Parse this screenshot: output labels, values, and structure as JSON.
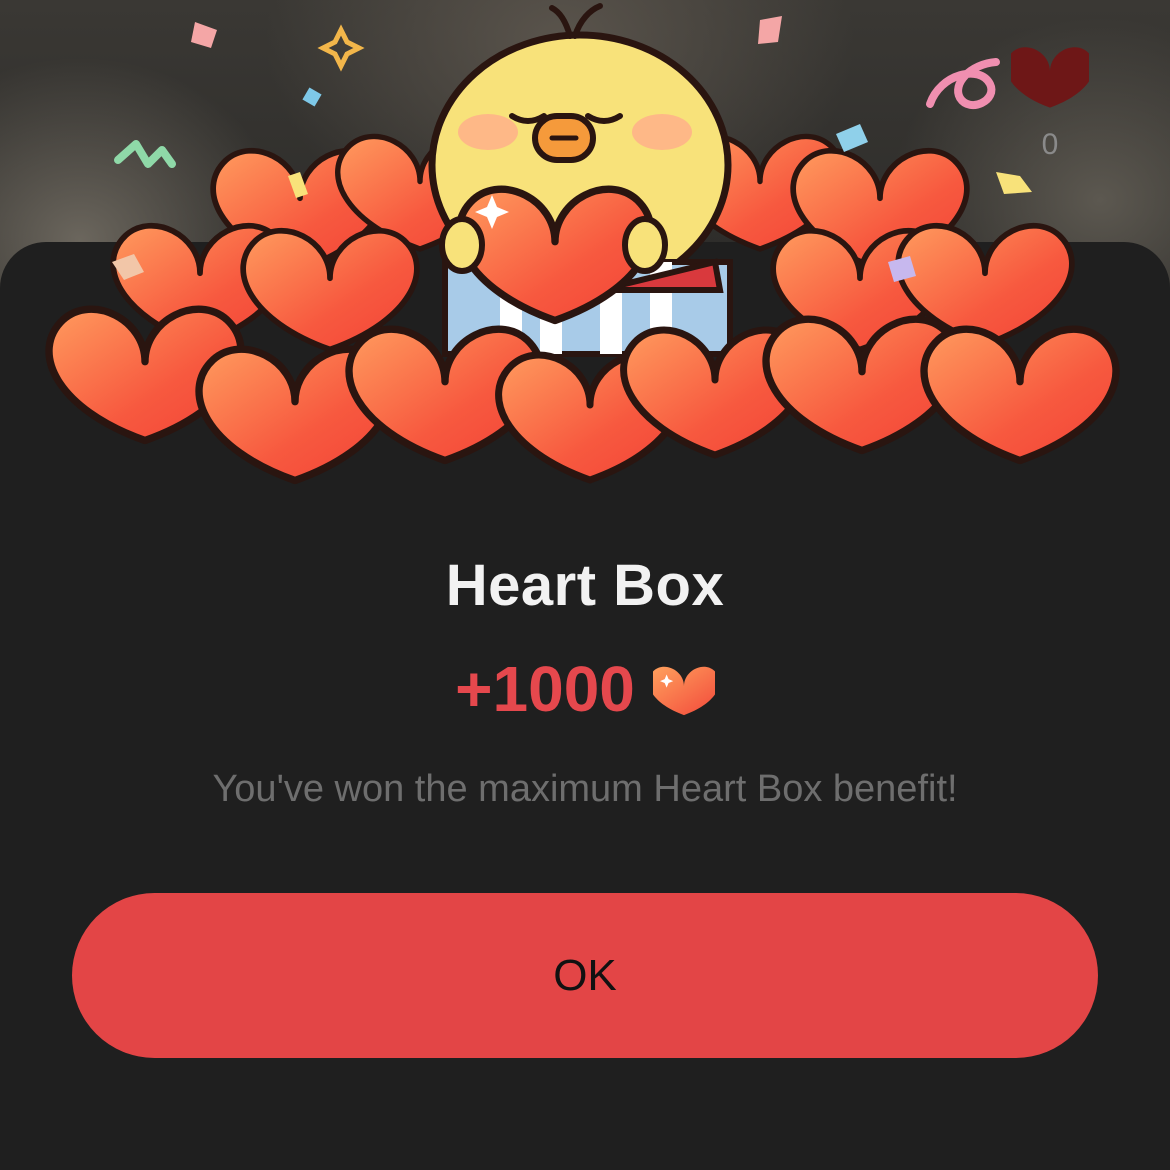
{
  "popup": {
    "title": "Heart Box",
    "reward_amount": "+1000",
    "message": "You've won the maximum Heart Box benefit!",
    "ok_label": "OK"
  },
  "like_indicator": {
    "count": "0",
    "icon": "heart-icon"
  },
  "illustration": {
    "icon": "chick-holding-heart-gift-box"
  },
  "colors": {
    "accent": "#e34546",
    "reward_text": "#e5484d",
    "sheet_background": "#1f1f1f",
    "title_text": "#f2f2f2",
    "message_text": "#6e6e6e",
    "heart_fill_light": "#ff9a5c",
    "heart_fill_dark": "#f24a3d",
    "chick_yellow": "#f8e27a"
  }
}
